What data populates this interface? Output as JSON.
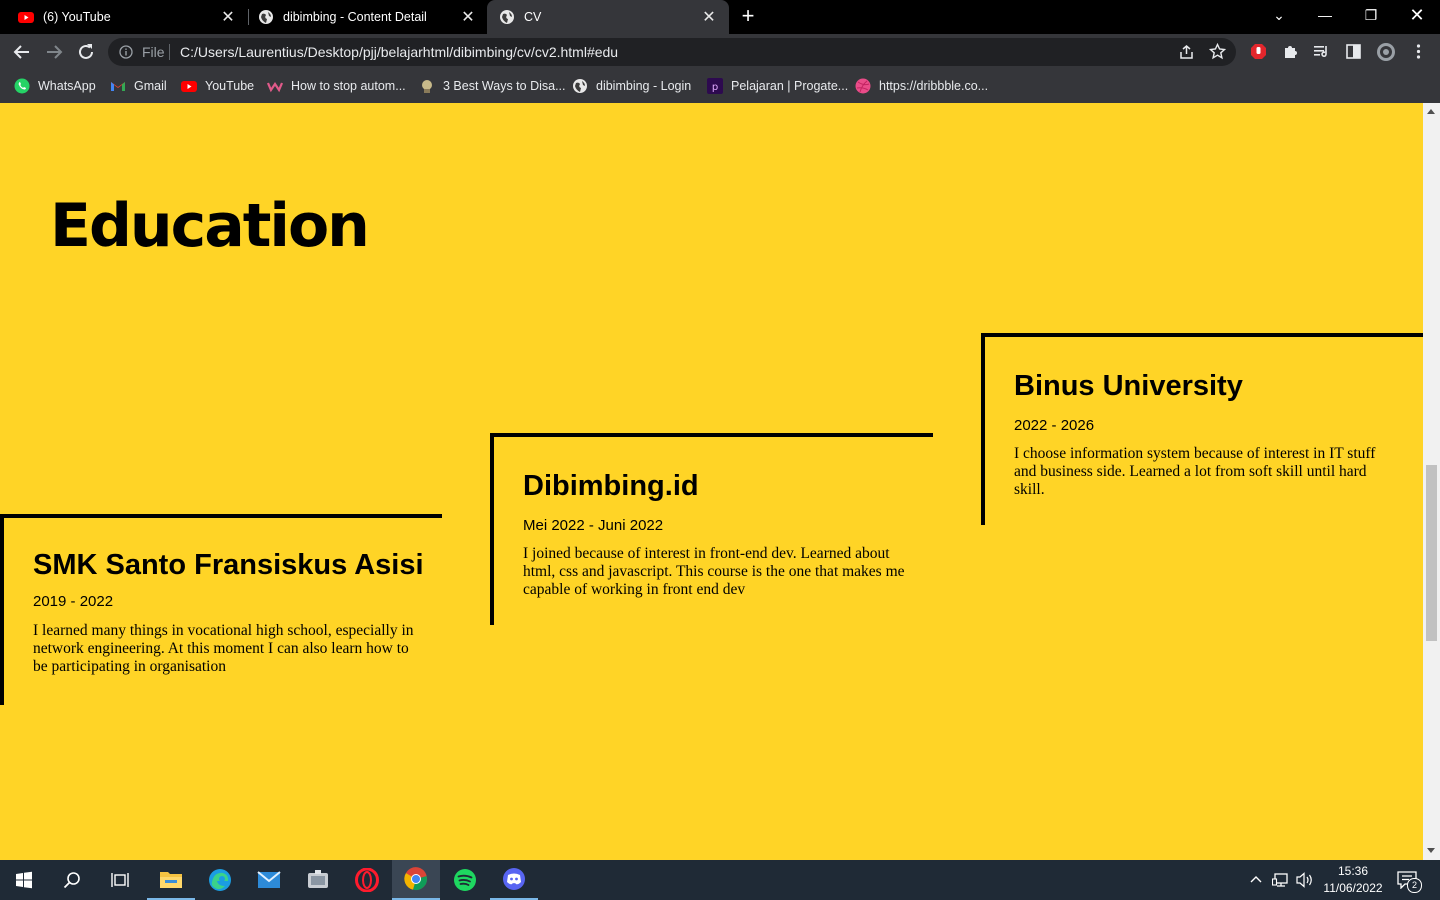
{
  "browser": {
    "tabs": [
      {
        "title": "(6) YouTube",
        "icon": "youtube-icon"
      },
      {
        "title": "dibimbing - Content Detail",
        "icon": "globe-icon"
      },
      {
        "title": "CV",
        "icon": "globe-icon",
        "active": true
      }
    ],
    "address": {
      "scheme": "File",
      "url": "C:/Users/Laurentius/Desktop/pjj/belajarhtml/dibimbing/cv/cv2.html#edu"
    },
    "bookmarks": [
      {
        "label": "WhatsApp",
        "icon": "whatsapp-icon"
      },
      {
        "label": "Gmail",
        "icon": "gmail-icon"
      },
      {
        "label": "YouTube",
        "icon": "youtube-icon"
      },
      {
        "label": "How to stop autom...",
        "icon": "bookmark-site-icon"
      },
      {
        "label": "3 Best Ways to Disa...",
        "icon": "bookmark-site-icon"
      },
      {
        "label": "dibimbing - Login",
        "icon": "globe-icon"
      },
      {
        "label": "Pelajaran | Progate...",
        "icon": "progate-icon"
      },
      {
        "label": "https://dribbble.co...",
        "icon": "dribbble-icon"
      }
    ]
  },
  "page": {
    "section_title": "Education",
    "background_color": "#ffd426",
    "education": [
      {
        "school": "SMK Santo Fransiskus Asisi",
        "years": "2019 - 2022",
        "description": "I learned many things in vocational high school, especially in network engineering. At this moment I can also learn how to be participating in organisation"
      },
      {
        "school": "Dibimbing.id",
        "years": "Mei 2022 - Juni 2022",
        "description": "I joined because of interest in front-end dev. Learned about html, css and javascript. This course is the one that makes me capable of working in front end dev"
      },
      {
        "school": "Binus University",
        "years": "2022 - 2026",
        "description": "I choose information system because of interest in IT stuff and business side. Learned a lot from soft skill until hard skill."
      }
    ]
  },
  "taskbar": {
    "apps": [
      "start-icon",
      "search-icon",
      "task-view-icon",
      "file-explorer-icon",
      "edge-icon",
      "mail-icon",
      "app-icon",
      "opera-icon",
      "chrome-icon",
      "spotify-icon",
      "discord-icon"
    ],
    "time": "15:36",
    "date": "11/06/2022",
    "notification_count": "2"
  }
}
